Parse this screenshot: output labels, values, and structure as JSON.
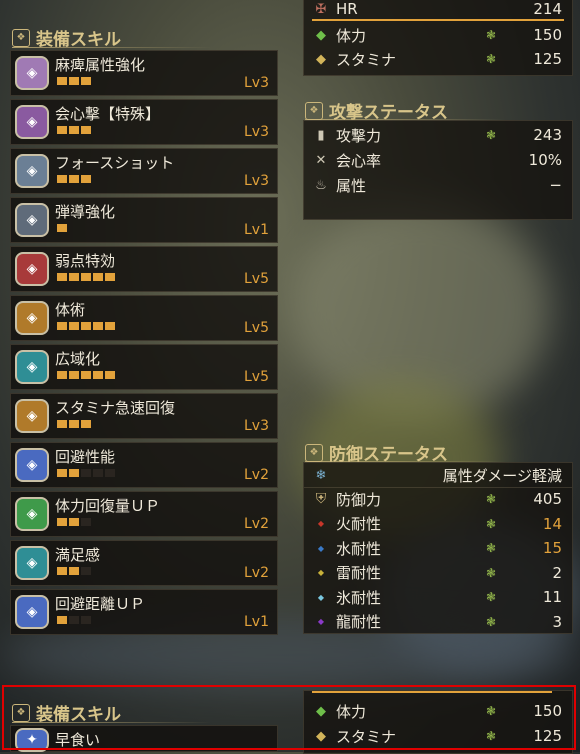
{
  "equip_skills": {
    "title": "装備スキル",
    "items": [
      {
        "name": "麻痺属性強化",
        "lv": "Lv3",
        "filled": 3,
        "total": 3,
        "color": "#a07ab4",
        "icon": "paralysis-icon"
      },
      {
        "name": "会心撃【特殊】",
        "lv": "Lv3",
        "filled": 3,
        "total": 3,
        "color": "#8a5aa0",
        "icon": "critical-element-icon"
      },
      {
        "name": "フォースショット",
        "lv": "Lv3",
        "filled": 3,
        "total": 3,
        "color": "#6b7f95",
        "icon": "force-shot-icon"
      },
      {
        "name": "弾導強化",
        "lv": "Lv1",
        "filled": 1,
        "total": 1,
        "color": "#5f6b7a",
        "icon": "ballistics-icon"
      },
      {
        "name": "弱点特効",
        "lv": "Lv5",
        "filled": 5,
        "total": 5,
        "color": "#a83a3a",
        "icon": "weakness-exploit-icon"
      },
      {
        "name": "体術",
        "lv": "Lv5",
        "filled": 5,
        "total": 5,
        "color": "#b07a2a",
        "icon": "constitution-icon"
      },
      {
        "name": "広域化",
        "lv": "Lv5",
        "filled": 5,
        "total": 5,
        "color": "#2f8e95",
        "icon": "wide-range-icon"
      },
      {
        "name": "スタミナ急速回復",
        "lv": "Lv3",
        "filled": 3,
        "total": 3,
        "color": "#b07a2a",
        "icon": "stamina-surge-icon"
      },
      {
        "name": "回避性能",
        "lv": "Lv2",
        "filled": 2,
        "total": 5,
        "color": "#4a6ac0",
        "icon": "evade-window-icon"
      },
      {
        "name": "体力回復量ＵＰ",
        "lv": "Lv2",
        "filled": 2,
        "total": 3,
        "color": "#3f9a4a",
        "icon": "recovery-up-icon"
      },
      {
        "name": "満足感",
        "lv": "Lv2",
        "filled": 2,
        "total": 3,
        "color": "#2f8e95",
        "icon": "satisfaction-icon"
      },
      {
        "name": "回避距離ＵＰ",
        "lv": "Lv1",
        "filled": 1,
        "total": 3,
        "color": "#4a6ac0",
        "icon": "evade-extender-icon"
      }
    ]
  },
  "top_stats": {
    "hr_label": "HR",
    "hr_value": "214",
    "health_label": "体力",
    "health_value": "150",
    "stamina_label": "スタミナ",
    "stamina_value": "125"
  },
  "attack_status": {
    "title": "攻撃ステータス",
    "rows": [
      {
        "label": "攻撃力",
        "value": "243",
        "icon": "attack-icon"
      },
      {
        "label": "会心率",
        "value": "10%",
        "icon": "affinity-icon"
      },
      {
        "label": "属性",
        "value": "−",
        "icon": "element-icon"
      }
    ]
  },
  "defense_status": {
    "title": "防御ステータス",
    "subheader": "属性ダメージ軽減",
    "rows": [
      {
        "label": "防御力",
        "value": "405",
        "icon": "defense-icon",
        "dot": "#c9b27a"
      },
      {
        "label": "火耐性",
        "value": "14",
        "icon": "fire-icon",
        "dot": "#c8362a",
        "gold": true
      },
      {
        "label": "水耐性",
        "value": "15",
        "icon": "water-icon",
        "dot": "#3a7ac8",
        "gold": true
      },
      {
        "label": "雷耐性",
        "value": "2",
        "icon": "thunder-icon",
        "dot": "#c9b23a"
      },
      {
        "label": "氷耐性",
        "value": "11",
        "icon": "ice-icon",
        "dot": "#7ac8e0"
      },
      {
        "label": "龍耐性",
        "value": "3",
        "icon": "dragon-icon",
        "dot": "#8a3ac8"
      }
    ]
  },
  "bottom_preview": {
    "skills_title": "装備スキル",
    "first_skill": "早食い",
    "health_label": "体力",
    "health_value": "150",
    "stamina_label": "スタミナ",
    "stamina_value": "125"
  }
}
